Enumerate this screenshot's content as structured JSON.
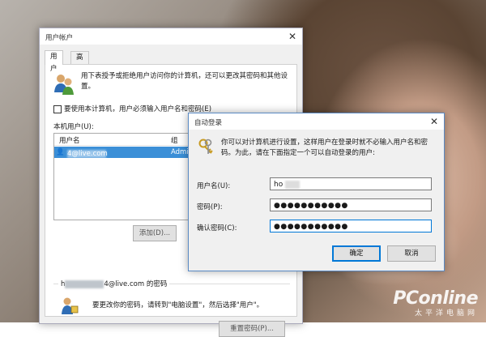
{
  "account_window": {
    "title": "用户帐户",
    "tabs": [
      {
        "label": "用户"
      },
      {
        "label": "高级"
      }
    ],
    "intro": "用下表授予或拒绝用户访问你的计算机，还可以更改其密码和其他设置。",
    "require_password_checkbox": "要使用本计算机，用户必须输入用户名和密码(E)",
    "users_label": "本机用户(U):",
    "columns": [
      "用户名",
      "组"
    ],
    "selected_user_suffix": "4@live.com",
    "selected_user_group": "Admin",
    "buttons": {
      "add": "添加(D)...",
      "reset_password": "重置密码(P)..."
    },
    "password_group_suffix": "4@live.com 的密码",
    "password_group_prefix": "h",
    "password_hint": "要更改你的密码，请转到\"电脑设置\"，然后选择\"用户\"。"
  },
  "autologon_dialog": {
    "title": "自动登录",
    "intro": "你可以对计算机进行设置，这样用户在登录时就不必输入用户名和密码。为此，请在下面指定一个可以自动登录的用户:",
    "fields": [
      {
        "label": "用户名(U):",
        "value": "ho"
      },
      {
        "label": "密码(P):",
        "value": "●●●●●●●●●●●"
      },
      {
        "label": "确认密码(C):",
        "value": "●●●●●●●●●●●"
      }
    ],
    "buttons": {
      "ok": "确定",
      "cancel": "取消"
    }
  },
  "watermark": {
    "main": "PConline",
    "sub": "太平洋电脑网"
  },
  "colors": {
    "selection": "#3b8fd7",
    "focus_border": "#0078d7"
  }
}
